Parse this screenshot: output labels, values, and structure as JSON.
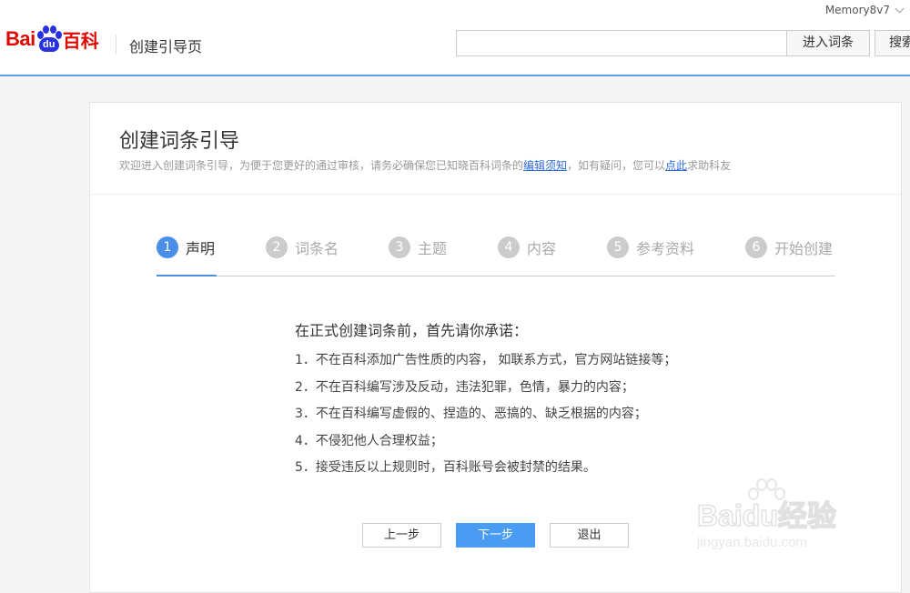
{
  "header": {
    "username": "Memory8v7",
    "logo": {
      "bai": "Bai",
      "du": "du",
      "baike": "百科"
    },
    "page_name": "创建引导页",
    "search": {
      "value": "",
      "placeholder": ""
    },
    "enter_entry_label": "进入词条",
    "search_label": "搜索"
  },
  "card": {
    "title": "创建词条引导",
    "subtitle": {
      "part1": "欢迎进入创建词条引导，为便于您更好的通过审核，请务必确保您已知晓百科词条的",
      "link1": "编辑须知",
      "part2": "，如有疑问，您可以",
      "link2": "点此",
      "part3": "求助科友"
    }
  },
  "steps": [
    {
      "num": "1",
      "label": "声明",
      "active": true
    },
    {
      "num": "2",
      "label": "词条名",
      "active": false
    },
    {
      "num": "3",
      "label": "主题",
      "active": false
    },
    {
      "num": "4",
      "label": "内容",
      "active": false
    },
    {
      "num": "5",
      "label": "参考资料",
      "active": false
    },
    {
      "num": "6",
      "label": "开始创建",
      "active": false
    }
  ],
  "terms": {
    "title": "在正式创建词条前，首先请你承诺：",
    "items": [
      "1．不在百科添加广告性质的内容， 如联系方式，官方网站链接等；",
      "2．不在百科编写涉及反动，违法犯罪，色情，暴力的内容；",
      "3．不在百科编写虚假的、捏造的、恶搞的、缺乏根据的内容；",
      "4．不侵犯他人合理权益；",
      "5．接受违反以上规则时，百科账号会被封禁的结果。"
    ]
  },
  "buttons": {
    "prev": "上一步",
    "next": "下一步",
    "exit": "退出"
  },
  "watermark": {
    "logo": "Baidu经验",
    "url": "jingyan.baidu.com"
  },
  "colors": {
    "accent": "#4a8ee8",
    "brand_red": "#e10601",
    "brand_blue": "#2932e1",
    "link": "#2e6bd6"
  }
}
